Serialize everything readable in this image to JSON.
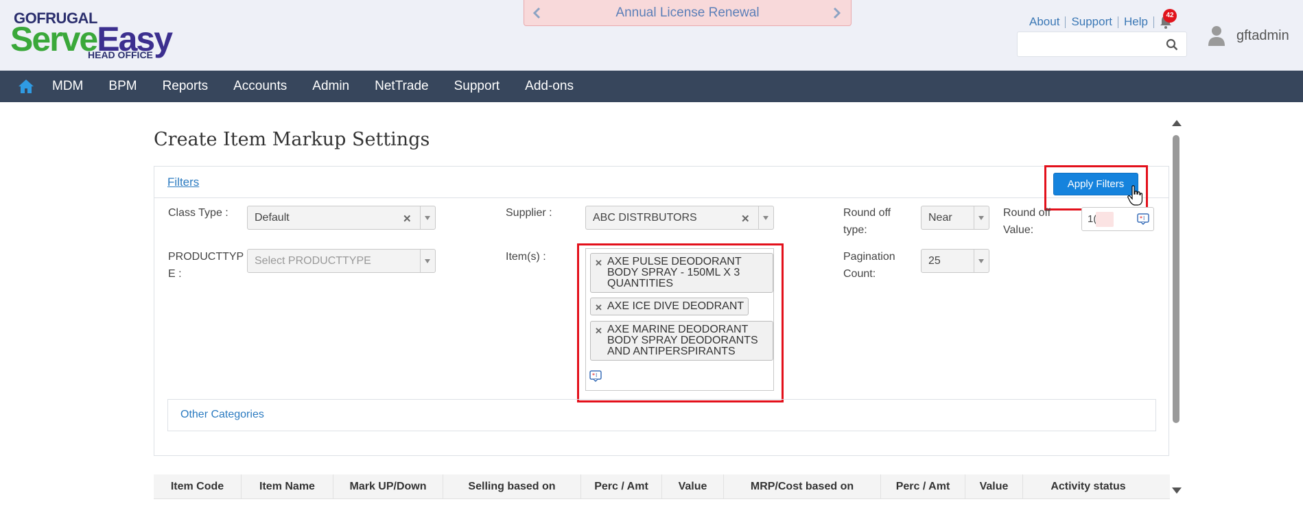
{
  "header": {
    "logo": {
      "top": "GOFRUGAL",
      "serve": "Serve",
      "easy": "Easy",
      "sub": "HEAD OFFICE"
    },
    "license_banner": "Annual License Renewal",
    "links": [
      "About",
      "Support",
      "Help"
    ],
    "notification_count": "42",
    "search": {
      "value": "",
      "placeholder": ""
    },
    "username": "gftadmin"
  },
  "navbar": {
    "items": [
      "MDM",
      "BPM",
      "Reports",
      "Accounts",
      "Admin",
      "NetTrade",
      "Support",
      "Add-ons"
    ]
  },
  "page": {
    "title": "Create Item Markup Settings",
    "filters_label": "Filters",
    "apply_filters_label": "Apply Filters",
    "fields": {
      "class_type": {
        "label": "Class Type :",
        "value": "Default"
      },
      "supplier": {
        "label": "Supplier :",
        "value": "ABC DISTRBUTORS"
      },
      "round_off_type": {
        "label": "Round off type:",
        "value": "Near"
      },
      "round_off_value": {
        "label": "Round off Value:",
        "value": "1("
      },
      "producttype": {
        "label": "PRODUCTTYPE :",
        "placeholder": "Select PRODUCTTYPE"
      },
      "items": {
        "label": "Item(s) :",
        "selected": [
          "AXE PULSE DEODORANT BODY SPRAY - 150ML X 3 QUANTITIES",
          "AXE ICE DIVE DEODRANT",
          "AXE MARINE DEODORANT BODY SPRAY DEODORANTS AND ANTIPERSPIRANTS"
        ]
      },
      "pagination_count": {
        "label": "Pagination Count:",
        "value": "25"
      }
    },
    "other_categories_label": "Other Categories"
  },
  "table": {
    "columns": [
      "Item Code",
      "Item Name",
      "Mark UP/Down",
      "Selling based on",
      "Perc / Amt",
      "Value",
      "MRP/Cost based on",
      "Perc / Amt",
      "Value",
      "Activity status"
    ]
  },
  "colors": {
    "navbar_bg": "#37465c",
    "primary_button": "#1583dd",
    "highlight_border": "#e3101b",
    "link": "#2a7ac0",
    "badge": "#e1141c"
  }
}
